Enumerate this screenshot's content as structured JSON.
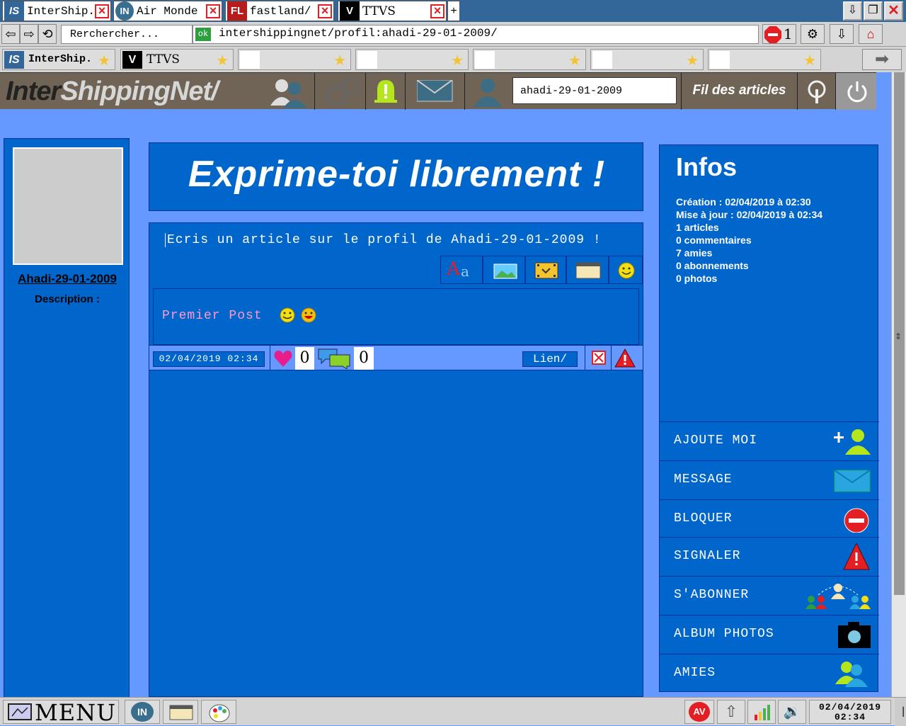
{
  "tabs": [
    {
      "icon": "IS",
      "label": "InterShip."
    },
    {
      "icon": "IN",
      "label": "Air Monde"
    },
    {
      "icon": "FL",
      "label": "fastland/"
    },
    {
      "icon": "V",
      "label": "TTVS"
    }
  ],
  "newtab": "+",
  "address": {
    "search_text": "Rerchercher...",
    "ok_badge": "ok",
    "url": "intershippingnet/profil:ahadi-29-01-2009/",
    "block_count": "1"
  },
  "bookmarks": [
    {
      "icon": "IS",
      "label": "InterShip."
    },
    {
      "icon": "V",
      "label": "TTVS"
    },
    {
      "icon": "",
      "label": ""
    },
    {
      "icon": "",
      "label": ""
    },
    {
      "icon": "",
      "label": ""
    },
    {
      "icon": "",
      "label": ""
    },
    {
      "icon": "",
      "label": ""
    }
  ],
  "site": {
    "logo_part1": "Inter",
    "logo_part2": "ShippingNet/",
    "search_value": "ahadi-29-01-2009",
    "feed_label": "Fil des articles"
  },
  "profile": {
    "name": "Ahadi-29-01-2009",
    "description_label": "Description :"
  },
  "main": {
    "banner": "Exprime-toi librement !",
    "compose_placeholder": "Ecris un article sur le profil de Ahadi-29-01-2009 !",
    "post": {
      "text": "Premier Post",
      "date": "02/04/2019 02:34",
      "likes": "0",
      "comments": "0",
      "link_label": "Lien/"
    }
  },
  "infos": {
    "title": "Infos",
    "lines": [
      "Création : 02/04/2019 à 02:30",
      "Mise à jour : 02/04/2019 à 02:34",
      "1 articles",
      "0 commentaires",
      "7 amies",
      "0 abonnements",
      "0 photos"
    ],
    "actions": [
      {
        "label": "AJOUTE MOI",
        "icon": "add-friend-icon"
      },
      {
        "label": "MESSAGE",
        "icon": "envelope-icon"
      },
      {
        "label": "BLOQUER",
        "icon": "block-icon"
      },
      {
        "label": "SIGNALER",
        "icon": "warning-icon"
      },
      {
        "label": "S'ABONNER",
        "icon": "subscribe-icon"
      },
      {
        "label": "ALBUM PHOTOS",
        "icon": "camera-icon"
      },
      {
        "label": "AMIES",
        "icon": "friends-icon"
      }
    ]
  },
  "taskbar": {
    "menu_label": "MENU",
    "in_badge": "IN",
    "av_badge": "AV",
    "date": "02/04/2019",
    "time": "02:34"
  },
  "colors": {
    "accent": "#0066cc",
    "page_bg": "#6699ff",
    "header_bg": "#6f6455",
    "close_red": "#e31e24"
  }
}
